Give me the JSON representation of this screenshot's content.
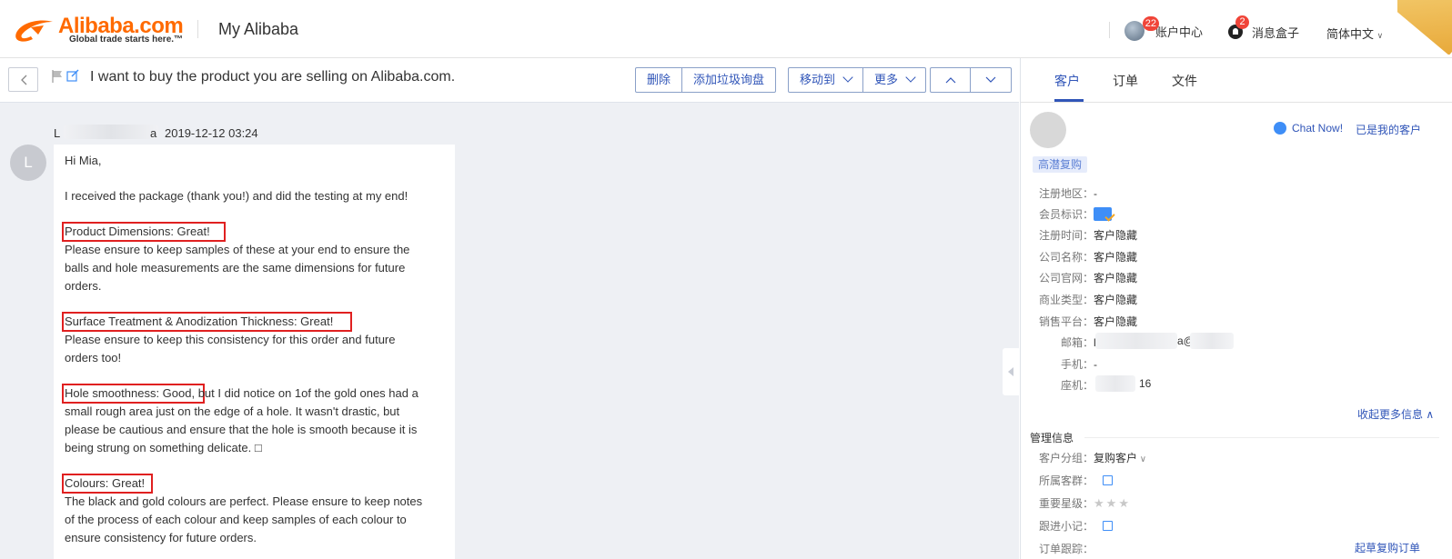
{
  "header": {
    "logo_text": "Alibaba.com",
    "logo_tagline": "Global trade starts here.™",
    "title": "My Alibaba",
    "account_badge": "22",
    "account_label": "账户中心",
    "message_badge": "2",
    "message_label": "消息盒子",
    "language": "简体中文"
  },
  "subject_bar": {
    "subject": "I want to buy the product you are selling on Alibaba.com.",
    "actions": [
      "删除",
      "添加垃圾询盘"
    ],
    "move_to": "移动到",
    "more": "更多"
  },
  "message": {
    "sender_initial": "L",
    "sender_start": "L",
    "sender_end": "a",
    "date": "2019-12-12 03:24",
    "avatar_letter": "L",
    "lines": [
      "Hi Mia,",
      "I received the package (thank you!) and did the testing at my end!",
      "Product Dimensions: Great!",
      "Please ensure to keep samples of these at your end to ensure the",
      "balls and hole measurements are the same dimensions for future",
      "orders.",
      "Surface Treatment & Anodization Thickness: Great!",
      "Please ensure to keep this consistency for this order and future",
      "orders too!",
      "Hole smoothness: Good, but I did notice on 1of the gold ones had a",
      "small rough area just on the edge of a hole. It wasn't drastic, but",
      "please be cautious and ensure that the hole is smooth because it is",
      "being strung on something delicate. □",
      "Colours: Great!",
      "The black and gold colours are perfect. Please ensure to keep notes",
      "of the process of each colour and keep samples of each colour to",
      "ensure consistency for future orders."
    ]
  },
  "customer_panel": {
    "tabs": [
      "客户",
      "订单",
      "文件"
    ],
    "chat_now": "Chat Now!",
    "my_customer": "已是我的客户",
    "tag": "高潜复购",
    "fields": [
      {
        "label": "注册地区：",
        "value": "-"
      },
      {
        "label": "会员标识：",
        "value": ""
      },
      {
        "label": "注册时间：",
        "value": "客户隐藏"
      },
      {
        "label": "公司名称：",
        "value": "客户隐藏"
      },
      {
        "label": "公司官网：",
        "value": "客户隐藏"
      },
      {
        "label": "商业类型：",
        "value": "客户隐藏"
      },
      {
        "label": "销售平台：",
        "value": "客户隐藏"
      }
    ],
    "contact": [
      {
        "label": "邮箱：",
        "value": "l"
      },
      {
        "label": "手机：",
        "value": "-"
      },
      {
        "label": "座机：",
        "value": "16"
      }
    ],
    "email_suffix": "a@",
    "collapse_label": "收起更多信息",
    "mgmt_title": "管理信息",
    "mgmt_fields": [
      {
        "label": "客户分组：",
        "value": "复购客户"
      },
      {
        "label": "所属客群：",
        "value": ""
      },
      {
        "label": "重要星级：",
        "value": ""
      },
      {
        "label": "跟进小记：",
        "value": ""
      },
      {
        "label": "订单跟踪：",
        "value": ""
      }
    ],
    "more_link": "起草复购订单"
  }
}
